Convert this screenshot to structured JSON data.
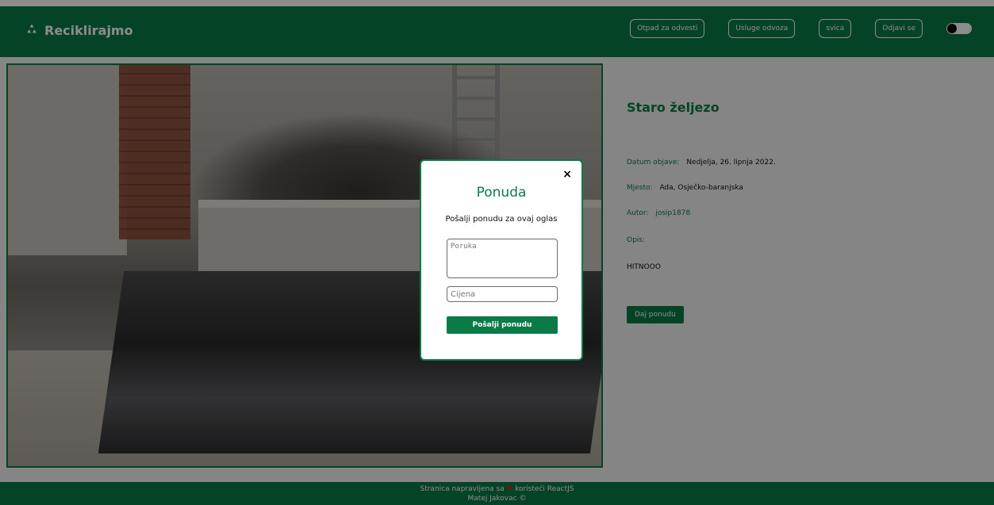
{
  "header": {
    "brand": "Reciklirajmo",
    "nav": [
      {
        "label": "Otpad za odvesti"
      },
      {
        "label": "Usluge odvoza"
      },
      {
        "label": "svica"
      },
      {
        "label": "Odjavi se"
      }
    ]
  },
  "listing": {
    "title": "Staro željezo",
    "date_label": "Datum objave:",
    "date_value": "Nedjelja, 26. lipnja 2022.",
    "place_label": "Mjesto:",
    "place_value": "Ada, Osječko-baranjska",
    "author_label": "Autor:",
    "author_value": "josip1878",
    "desc_label": "Opis:",
    "desc_value": "HITNOOO",
    "offer_button": "Daj ponudu"
  },
  "modal": {
    "title": "Ponuda",
    "subtitle": "Pošalji ponudu za ovaj oglas",
    "message_placeholder": "Poruka",
    "price_placeholder": "Cijena",
    "submit_label": "Pošalji ponudu",
    "close_symbol": "×"
  },
  "footer": {
    "line1_pre": "Stranica napravljena sa",
    "line1_post": "koristeći ReactJS",
    "line2": "Matej Jakovac ©",
    "heart": "❤"
  },
  "colors": {
    "brand_green": "#0a7b47"
  }
}
